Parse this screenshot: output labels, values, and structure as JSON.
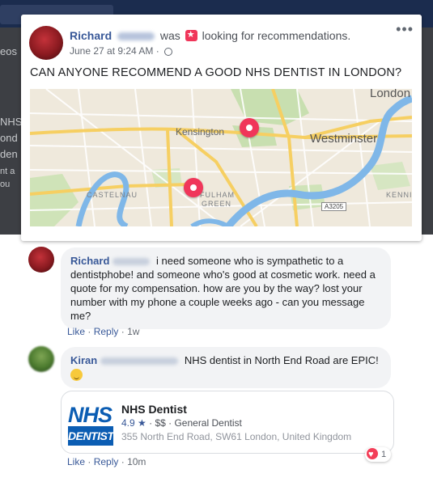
{
  "backdrop": {
    "left_texts": [
      "eos",
      "NHS",
      "ond",
      "den",
      "nt a",
      "ou"
    ]
  },
  "post": {
    "author": "Richard",
    "verb": "was",
    "action": "looking for recommendations.",
    "date": "June 27 at 9:24 AM",
    "dot": "·",
    "more": "•••",
    "text": "CAN ANYONE RECOMMEND A GOOD NHS DENTIST IN LONDON?",
    "map": {
      "labels": [
        "London",
        "Kensington",
        "Westminster",
        "CASTELNAU",
        "FULHAM",
        "GREEN",
        "KENNING",
        "A3205"
      ],
      "pins": [
        "pin-kensington",
        "pin-fulham"
      ]
    }
  },
  "comments": [
    {
      "author": "Richard",
      "text": "i need someone who is sympathetic to a dentistphobe! and someone who's good at cosmetic work. need a quote for my compensation. how are you by the way? lost your number with my phone a couple weeks ago - can you message me?",
      "like": "Like",
      "reply": "Reply",
      "sep": "·",
      "time": "1w"
    },
    {
      "author": "Kiran",
      "text": "NHS dentist in North End Road are EPIC!",
      "emoji_icon": "hugging-face-icon",
      "like": "Like",
      "reply": "Reply",
      "sep": "·",
      "time": "10m",
      "card": {
        "logo_top": "NHS",
        "logo_bottom": "DENTIST",
        "name": "NHS Dentist",
        "rating": "4.9 ★",
        "details": " · $$ · General Dentist",
        "address": "355 North End Road, SW61 London, United Kingdom"
      },
      "reaction_count": "1",
      "reaction_icon": "heart-icon"
    }
  ],
  "colors": {
    "link": "#385898",
    "pin": "#f0365a",
    "nhs_blue": "#0b5db3",
    "bubble": "#f2f3f5"
  }
}
